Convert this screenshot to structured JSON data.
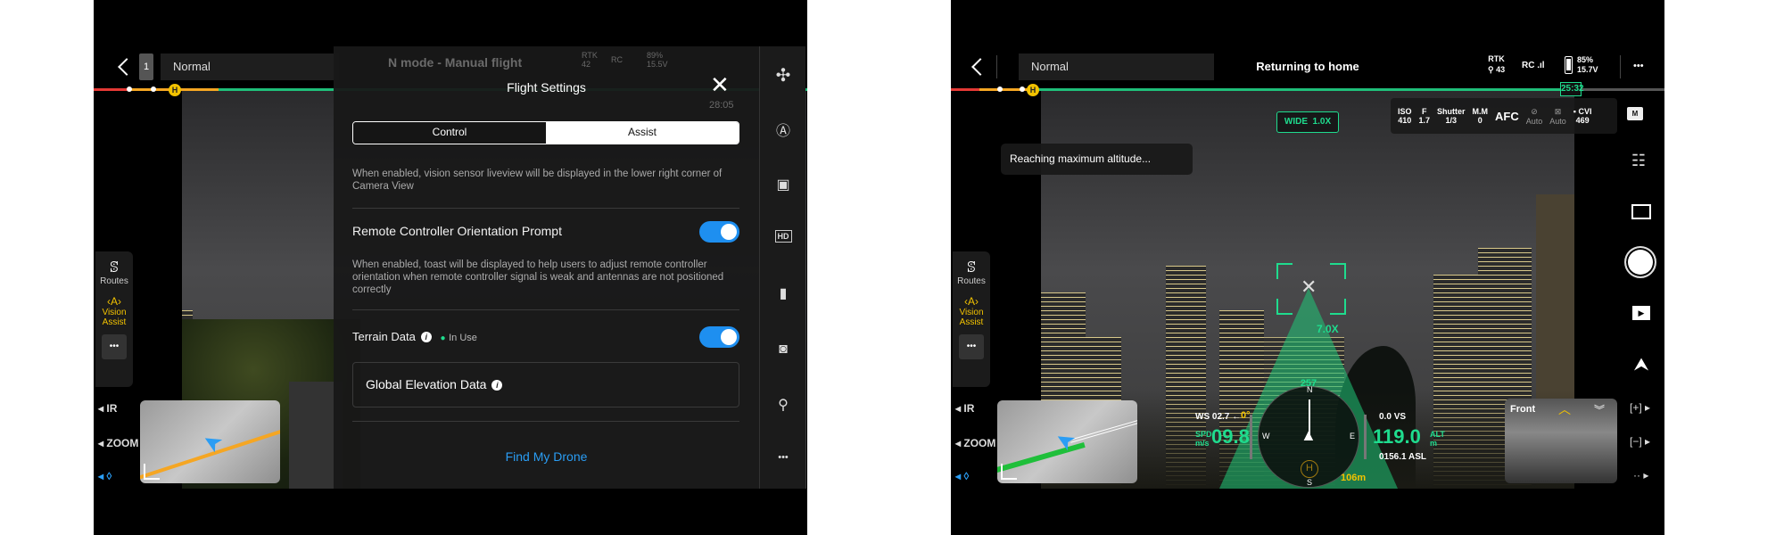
{
  "left": {
    "back_icon": "chevron-left-icon",
    "camera_index": "1",
    "flight_mode": "Normal",
    "bg_status": {
      "mode": "N mode - Manual flight",
      "rtk": "RTK",
      "rtk_sats": "42",
      "rc": "RC",
      "battery_pct": "89%",
      "battery_v": "15.5V",
      "flight_time": "28:05"
    },
    "left_menu": {
      "routes": "Routes",
      "vision_assist": "Vision Assist",
      "more": "•••",
      "ir": "IR",
      "zoom": "ZOOM"
    },
    "flight_settings": {
      "title": "Flight Settings",
      "close_icon": "close-icon",
      "tabs": [
        {
          "label": "Control",
          "active": false
        },
        {
          "label": "Assist",
          "active": true
        }
      ],
      "vision_desc": "When enabled, vision sensor liveview will be displayed in the lower right corner of Camera View",
      "rc_prompt": {
        "label": "Remote Controller Orientation Prompt",
        "enabled": true,
        "desc": "When enabled, toast will be displayed to help users to adjust remote controller orientation when remote controller signal is weak and antennas are not positioned correctly"
      },
      "terrain": {
        "label": "Terrain Data",
        "status": "In Use",
        "enabled": true
      },
      "global_elevation": "Global Elevation Data",
      "find_drone": "Find My Drone"
    },
    "right_sidebar_icons": [
      "drone-icon",
      "auto-pilot-icon",
      "remote-controller-icon",
      "hd-icon",
      "battery-nav-icon",
      "camera-icon",
      "satellite-icon",
      "more-icon"
    ],
    "right_sidebar_hd": "HD",
    "more": "•••"
  },
  "right": {
    "flight_mode": "Normal",
    "status_title": "Returning to home",
    "rtk": "RTK",
    "rtk_sats": "43",
    "rc": "RC",
    "battery_pct": "85%",
    "battery_v": "15.7V",
    "more": "•••",
    "flight_time": "25:32",
    "lens": "WIDE  1.0X",
    "camera_params": [
      {
        "label": "ISO",
        "value": "410"
      },
      {
        "label": "F",
        "value": "1.7"
      },
      {
        "label": "Shutter",
        "value": "1/3"
      },
      {
        "label": "M.M",
        "value": "0"
      }
    ],
    "focus_mode": "AFC",
    "wb": "Auto",
    "color": "Auto",
    "storage_label": "CVI",
    "storage_count": "469",
    "toast": "Reaching maximum altitude...",
    "zoom_level": "7.0X",
    "hud": {
      "heading": "257",
      "wind_speed": "WS 02.7",
      "gimbal_pitch": "0°",
      "speed_label": "SPD",
      "speed_unit": "m/s",
      "speed": "09.8",
      "vs": "0.0",
      "vs_label": "VS",
      "altitude": "119.0",
      "alt_label": "ALT",
      "alt_unit": "m",
      "asl": "0156.1 ASL",
      "home_distance": "106m",
      "compass": [
        "N",
        "E",
        "S",
        "W"
      ]
    },
    "left_menu": {
      "routes": "Routes",
      "vision_assist": "Vision Assist",
      "more": "•••",
      "ir": "IR",
      "zoom": "ZOOM"
    },
    "vision_panel": {
      "label": "Front"
    },
    "zoom_in": "[+]",
    "zoom_out": "[−]",
    "colors": {
      "accent": "#1fdc8e",
      "warning": "#f2c200",
      "toggle": "#1e8ff0",
      "link": "#2a9df4"
    }
  }
}
